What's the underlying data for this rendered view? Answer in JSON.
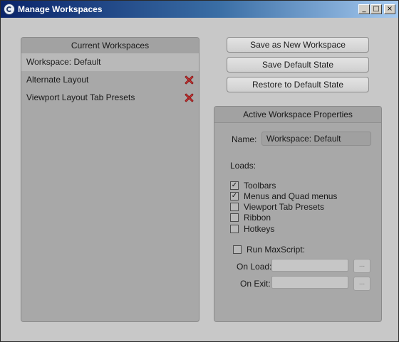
{
  "window": {
    "title": "Manage Workspaces",
    "controls": {
      "minimize": "_",
      "maximize": "□",
      "close": "×"
    }
  },
  "workspaces": {
    "header": "Current Workspaces",
    "items": [
      {
        "label": "Workspace: Default",
        "selected": true,
        "deletable": false
      },
      {
        "label": "Alternate Layout",
        "selected": false,
        "deletable": true
      },
      {
        "label": "Viewport Layout Tab Presets",
        "selected": false,
        "deletable": true
      }
    ]
  },
  "actions": {
    "save_new": "Save as New Workspace",
    "save_default": "Save Default State",
    "restore_default": "Restore to Default State"
  },
  "properties": {
    "header": "Active Workspace Properties",
    "name_label": "Name:",
    "name_value": "Workspace: Default",
    "loads_label": "Loads:",
    "loads": [
      {
        "label": "Toolbars",
        "checked": true
      },
      {
        "label": "Menus and Quad menus",
        "checked": true
      },
      {
        "label": "Viewport Tab Presets",
        "checked": false
      },
      {
        "label": "Ribbon",
        "checked": false
      },
      {
        "label": "Hotkeys",
        "checked": false
      }
    ],
    "run_maxscript": {
      "label": "Run MaxScript:",
      "checked": false
    },
    "on_load": {
      "label": "On Load:",
      "value": "",
      "browse": "..."
    },
    "on_exit": {
      "label": "On Exit:",
      "value": "",
      "browse": "..."
    }
  }
}
